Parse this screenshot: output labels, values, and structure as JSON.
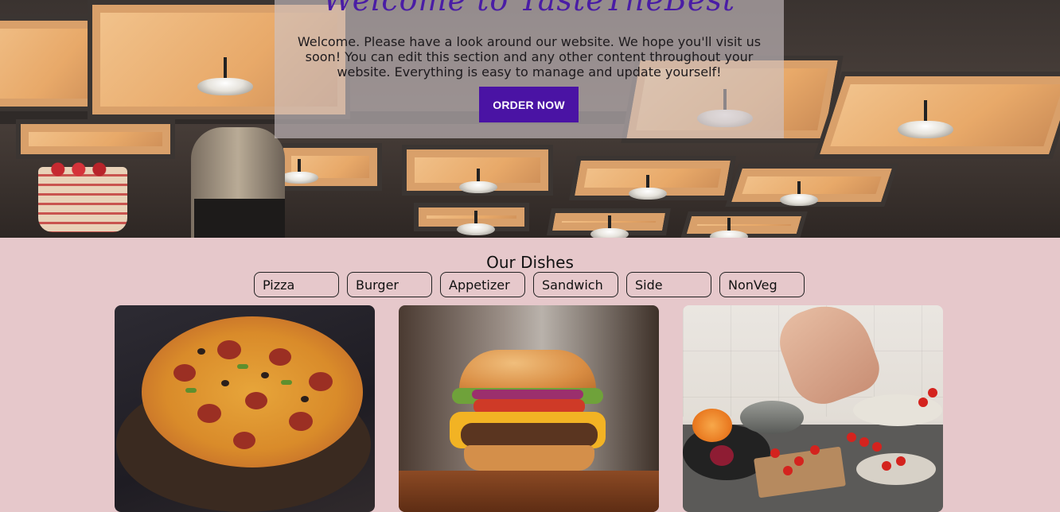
{
  "hero": {
    "title": "Welcome to TasteTheBest",
    "text": "Welcome. Please have a look around our website. We hope you'll visit us soon! You can edit this section and any other content throughout your website. Everything is easy to manage and update yourself!",
    "order_button": "ORDER NOW"
  },
  "dishes": {
    "title": "Our Dishes",
    "filters": [
      "Pizza",
      "Burger",
      "Appetizer",
      "Sandwich",
      "Side",
      "NonVeg"
    ]
  },
  "colors": {
    "accent": "#4a13a4",
    "background": "#e6c8cb",
    "hero_title": "#4a1da5"
  }
}
